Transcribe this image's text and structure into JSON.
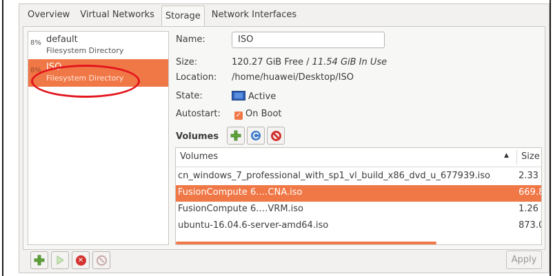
{
  "tabs": [
    {
      "label": "Overview"
    },
    {
      "label": "Virtual Networks"
    },
    {
      "label": "Storage",
      "active": true
    },
    {
      "label": "Network Interfaces"
    }
  ],
  "pools": [
    {
      "usage": "8%",
      "name": "default",
      "type": "Filesystem Directory",
      "selected": false
    },
    {
      "usage": "8%",
      "name": "ISO",
      "type": "Filesystem Directory",
      "selected": true
    }
  ],
  "details": {
    "name_label": "Name:",
    "name_value": "ISO",
    "size_label": "Size:",
    "size_free": "120.27 GiB Free / ",
    "size_used": "11.54 GiB In Use",
    "location_label": "Location:",
    "location_value": "/home/huawei/Desktop/ISO",
    "state_label": "State:",
    "state_value": "Active",
    "state_icon": "monitor-icon",
    "autostart_label": "Autostart:",
    "autostart_value": "On Boot",
    "autostart_checked": true
  },
  "volumes": {
    "title": "Volumes",
    "toolbar": {
      "add_icon": "plus-icon",
      "refresh_icon": "refresh-icon",
      "delete_icon": "delete-icon"
    },
    "columns": {
      "name": "Volumes",
      "size": "Size"
    },
    "rows": [
      {
        "name": "cn_windows_7_professional_with_sp1_vl_build_x86_dvd_u_677939.iso",
        "size": "2.33 (",
        "selected": false
      },
      {
        "name": "FusionCompute 6.…CNA.iso",
        "size": "669.8",
        "selected": true
      },
      {
        "name": "FusionCompute 6.…VRM.iso",
        "size": "1.26 (",
        "selected": false
      },
      {
        "name": "ubuntu-16.04.6-server-amd64.iso",
        "size": "873.0",
        "selected": false
      }
    ]
  },
  "bottom": {
    "add_icon": "plus-icon",
    "start_icon": "play-icon",
    "stop_icon": "stop-icon",
    "delete_icon": "delete-icon",
    "apply_label": "Apply"
  },
  "colors": {
    "selection": "#f07746",
    "annotation": "#e3141c",
    "window_bg": "#f2f1f0"
  }
}
